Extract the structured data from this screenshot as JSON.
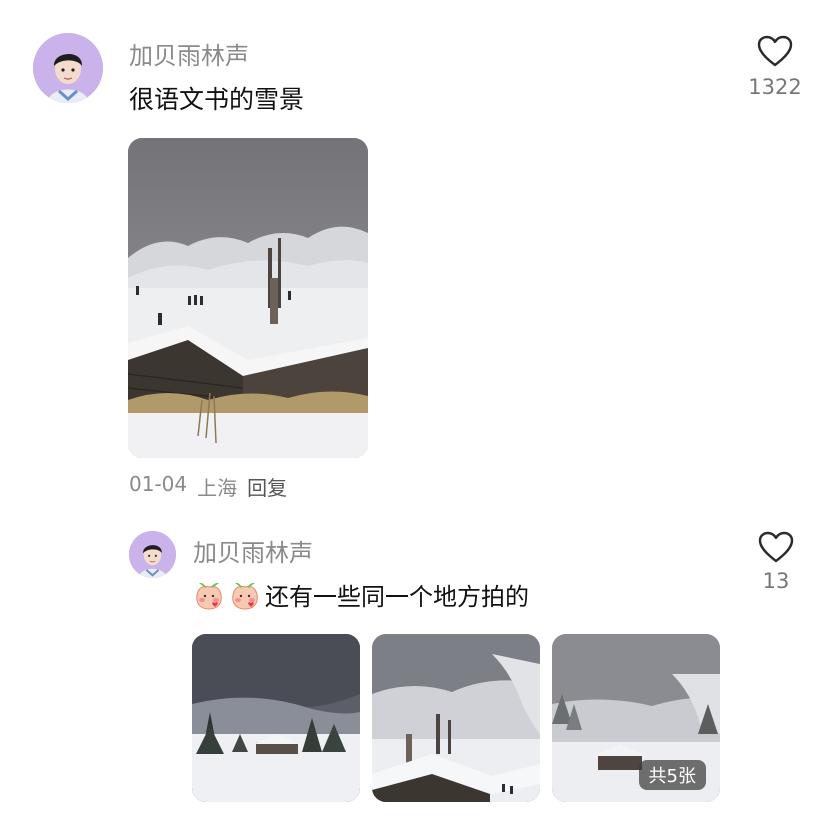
{
  "comment": {
    "username": "加贝雨林声",
    "text": "很语文书的雪景",
    "like_count": "1322",
    "date": "01-04",
    "location": "上海",
    "reply_label": "回复"
  },
  "reply": {
    "username": "加贝雨林声",
    "text": "还有一些同一个地方拍的",
    "like_count": "13",
    "image_count_badge": "共5张"
  },
  "colors": {
    "avatar_bg": "#c9b3ea",
    "muted_text": "#8a8a8a"
  }
}
